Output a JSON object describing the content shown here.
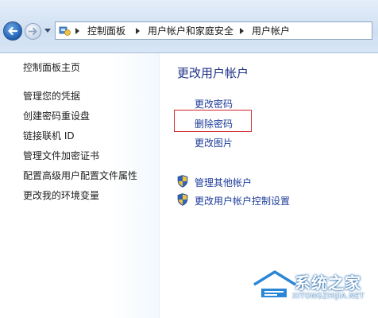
{
  "address_bar": {
    "crumbs": [
      "控制面板",
      "用户帐户和家庭安全",
      "用户帐户"
    ]
  },
  "left_pane": {
    "home_link": "控制面板主页",
    "links": [
      "管理您的凭据",
      "创建密码重设盘",
      "链接联机 ID",
      "管理文件加密证书",
      "配置高级用户配置文件属性",
      "更改我的环境变量"
    ]
  },
  "main": {
    "title": "更改用户帐户",
    "tasks": [
      "更改密码",
      "删除密码",
      "更改图片"
    ],
    "shield_tasks": [
      "管理其他帐户",
      "更改用户帐户控制设置"
    ]
  },
  "watermark": {
    "name": "系统之家",
    "url": "XITONGZHIJIA.NET"
  },
  "colors": {
    "link": "#1e3c9a",
    "title": "#1e3287",
    "highlight_box": "#d2232a"
  },
  "icons": [
    "back-arrow-icon",
    "forward-arrow-icon",
    "control-panel-icon",
    "uac-shield-icon",
    "house-logo-icon"
  ]
}
